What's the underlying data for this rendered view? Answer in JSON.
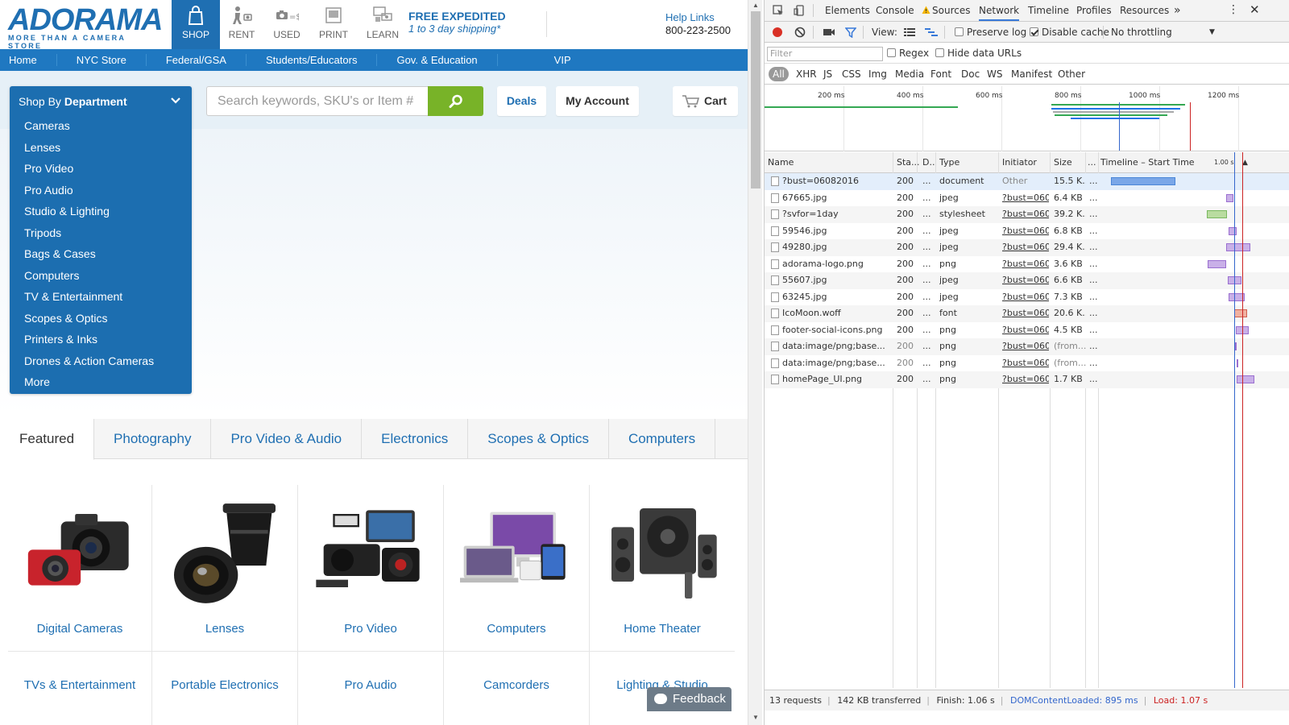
{
  "site": {
    "logo": {
      "text": "ADORAMA",
      "tagline": "MORE THAN A CAMERA STORE"
    },
    "nav_icons": [
      {
        "label": "SHOP",
        "icon": "shopping-bag-icon",
        "active": true
      },
      {
        "label": "RENT",
        "icon": "rent-person-icon",
        "active": false
      },
      {
        "label": "USED",
        "icon": "used-camera-dollar-icon",
        "active": false
      },
      {
        "label": "PRINT",
        "icon": "print-photo-icon",
        "active": false
      },
      {
        "label": "LEARN",
        "icon": "learn-screen-icon",
        "active": false
      }
    ],
    "shipping": {
      "title": "FREE EXPEDITED",
      "subtitle": "1 to 3 day shipping*"
    },
    "help": {
      "label": "Help Links",
      "phone": "800-223-2500"
    },
    "navbar": [
      "Home",
      "NYC Store",
      "Federal/GSA",
      "Students/Educators",
      "Gov. & Education",
      "VIP"
    ],
    "department": {
      "title_prefix": "Shop By",
      "title_bold": "Department",
      "items": [
        "Cameras",
        "Lenses",
        "Pro Video",
        "Pro Audio",
        "Studio & Lighting",
        "Tripods",
        "Bags & Cases",
        "Computers",
        "TV & Entertainment",
        "Scopes & Optics",
        "Printers & Inks",
        "Drones & Action Cameras",
        "More"
      ]
    },
    "search": {
      "placeholder": "Search keywords, SKU's or Item #"
    },
    "buttons": {
      "deals": "Deals",
      "account": "My Account",
      "cart": "Cart"
    },
    "tabs": [
      "Featured",
      "Photography",
      "Pro Video & Audio",
      "Electronics",
      "Scopes & Optics",
      "Computers"
    ],
    "active_tab": "Featured",
    "categories_row1": [
      "Digital Cameras",
      "Lenses",
      "Pro Video",
      "Computers",
      "Home Theater"
    ],
    "categories_row2": [
      "TVs & Entertainment",
      "Portable Electronics",
      "Pro Audio",
      "Camcorders",
      "Lighting & Studio"
    ],
    "feedback": "Feedback",
    "colors": {
      "brand": "#1f6fb2",
      "navbar": "#1f78c1",
      "search_button": "#78b328"
    }
  },
  "devtools": {
    "tabs": [
      "Elements",
      "Console",
      "Sources",
      "Network",
      "Timeline",
      "Profiles",
      "Resources"
    ],
    "active_tab": "Network",
    "more": "»",
    "toolbar": {
      "view": "View:",
      "preserve_log": "Preserve log",
      "disable_cache": "Disable cache",
      "throttling": "No throttling",
      "preserve_log_checked": false,
      "disable_cache_checked": true
    },
    "filter": {
      "placeholder": "Filter",
      "regex": "Regex",
      "hide_data": "Hide data URLs"
    },
    "types": [
      "All",
      "XHR",
      "JS",
      "CSS",
      "Img",
      "Media",
      "Font",
      "Doc",
      "WS",
      "Manifest",
      "Other"
    ],
    "overview_ticks": [
      "200 ms",
      "400 ms",
      "600 ms",
      "800 ms",
      "1000 ms",
      "1200 ms"
    ],
    "columns": [
      "Name",
      "Sta...",
      "D..",
      "Type",
      "Initiator",
      "Size",
      "...",
      "Timeline – Start Time",
      "1.00 s"
    ],
    "requests": [
      {
        "name": "?bust=06082016",
        "status": "200",
        "d": "...",
        "type": "document",
        "initiator": "Other",
        "size": "15.5 K...",
        "more": "..."
      },
      {
        "name": "67665.jpg",
        "status": "200",
        "d": "...",
        "type": "jpeg",
        "initiator": "?bust=060...",
        "size": "6.4 KB",
        "more": "..."
      },
      {
        "name": "?svfor=1day",
        "status": "200",
        "d": "...",
        "type": "stylesheet",
        "initiator": "?bust=060...",
        "size": "39.2 K...",
        "more": "..."
      },
      {
        "name": "59546.jpg",
        "status": "200",
        "d": "...",
        "type": "jpeg",
        "initiator": "?bust=060...",
        "size": "6.8 KB",
        "more": "..."
      },
      {
        "name": "49280.jpg",
        "status": "200",
        "d": "...",
        "type": "jpeg",
        "initiator": "?bust=060...",
        "size": "29.4 K...",
        "more": "..."
      },
      {
        "name": "adorama-logo.png",
        "status": "200",
        "d": "...",
        "type": "png",
        "initiator": "?bust=060...",
        "size": "3.6 KB",
        "more": "..."
      },
      {
        "name": "55607.jpg",
        "status": "200",
        "d": "...",
        "type": "jpeg",
        "initiator": "?bust=060...",
        "size": "6.6 KB",
        "more": "..."
      },
      {
        "name": "63245.jpg",
        "status": "200",
        "d": "...",
        "type": "jpeg",
        "initiator": "?bust=060...",
        "size": "7.3 KB",
        "more": "..."
      },
      {
        "name": "IcoMoon.woff",
        "status": "200",
        "d": "...",
        "type": "font",
        "initiator": "?bust=060...",
        "size": "20.6 K...",
        "more": "..."
      },
      {
        "name": "footer-social-icons.png",
        "status": "200",
        "d": "...",
        "type": "png",
        "initiator": "?bust=060...",
        "size": "4.5 KB",
        "more": "..."
      },
      {
        "name": "data:image/png;base...",
        "status": "200",
        "d": "...",
        "type": "png",
        "initiator": "?bust=060...",
        "size": "(from...",
        "more": "..."
      },
      {
        "name": "data:image/png;base...",
        "status": "200",
        "d": "...",
        "type": "png",
        "initiator": "?bust=060...",
        "size": "(from...",
        "more": "..."
      },
      {
        "name": "homePage_UI.png",
        "status": "200",
        "d": "...",
        "type": "png",
        "initiator": "?bust=060...",
        "size": "1.7 KB",
        "more": "..."
      }
    ],
    "summary": {
      "requests": "13 requests",
      "transferred": "142 KB transferred",
      "finish": "Finish: 1.06 s",
      "dcl": "DOMContentLoaded: 895 ms",
      "load": "Load: 1.07 s"
    },
    "colors": {
      "dcl": "#3366cc",
      "load": "#cc2222",
      "selected_row": "#e3eefb"
    }
  }
}
